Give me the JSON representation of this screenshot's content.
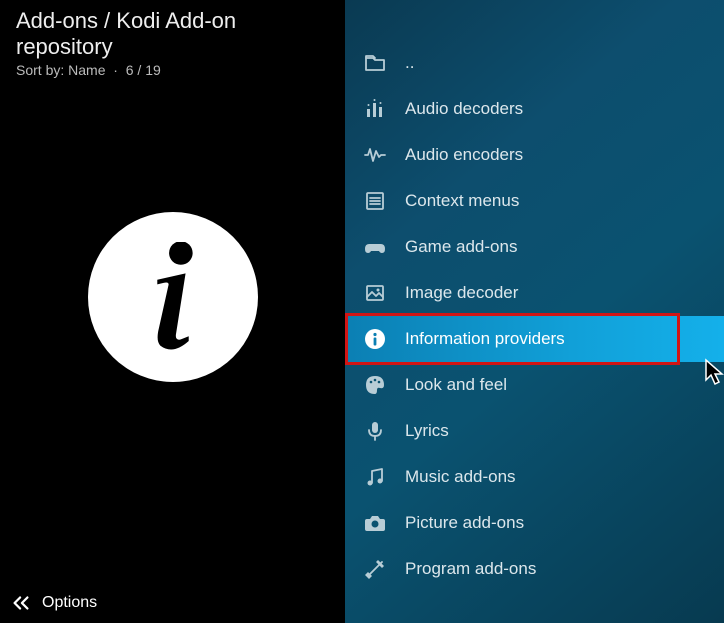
{
  "header": {
    "breadcrumb": "Add-ons / Kodi Add-on repository",
    "sort_label": "Sort by:",
    "sort_value": "Name",
    "position": "6 / 19"
  },
  "footer": {
    "options_label": "Options"
  },
  "list": {
    "items": [
      {
        "label": "..",
        "icon": "folder-up-icon"
      },
      {
        "label": "Audio decoders",
        "icon": "equalizer-icon"
      },
      {
        "label": "Audio encoders",
        "icon": "waveform-icon"
      },
      {
        "label": "Context menus",
        "icon": "menu-list-icon"
      },
      {
        "label": "Game add-ons",
        "icon": "gamepad-icon"
      },
      {
        "label": "Image decoder",
        "icon": "image-frame-icon"
      },
      {
        "label": "Information providers",
        "icon": "info-icon",
        "selected": true,
        "highlighted": true
      },
      {
        "label": "Look and feel",
        "icon": "palette-icon"
      },
      {
        "label": "Lyrics",
        "icon": "microphone-icon"
      },
      {
        "label": "Music add-ons",
        "icon": "music-note-icon"
      },
      {
        "label": "Picture add-ons",
        "icon": "camera-icon"
      },
      {
        "label": "Program add-ons",
        "icon": "tools-icon"
      }
    ]
  }
}
